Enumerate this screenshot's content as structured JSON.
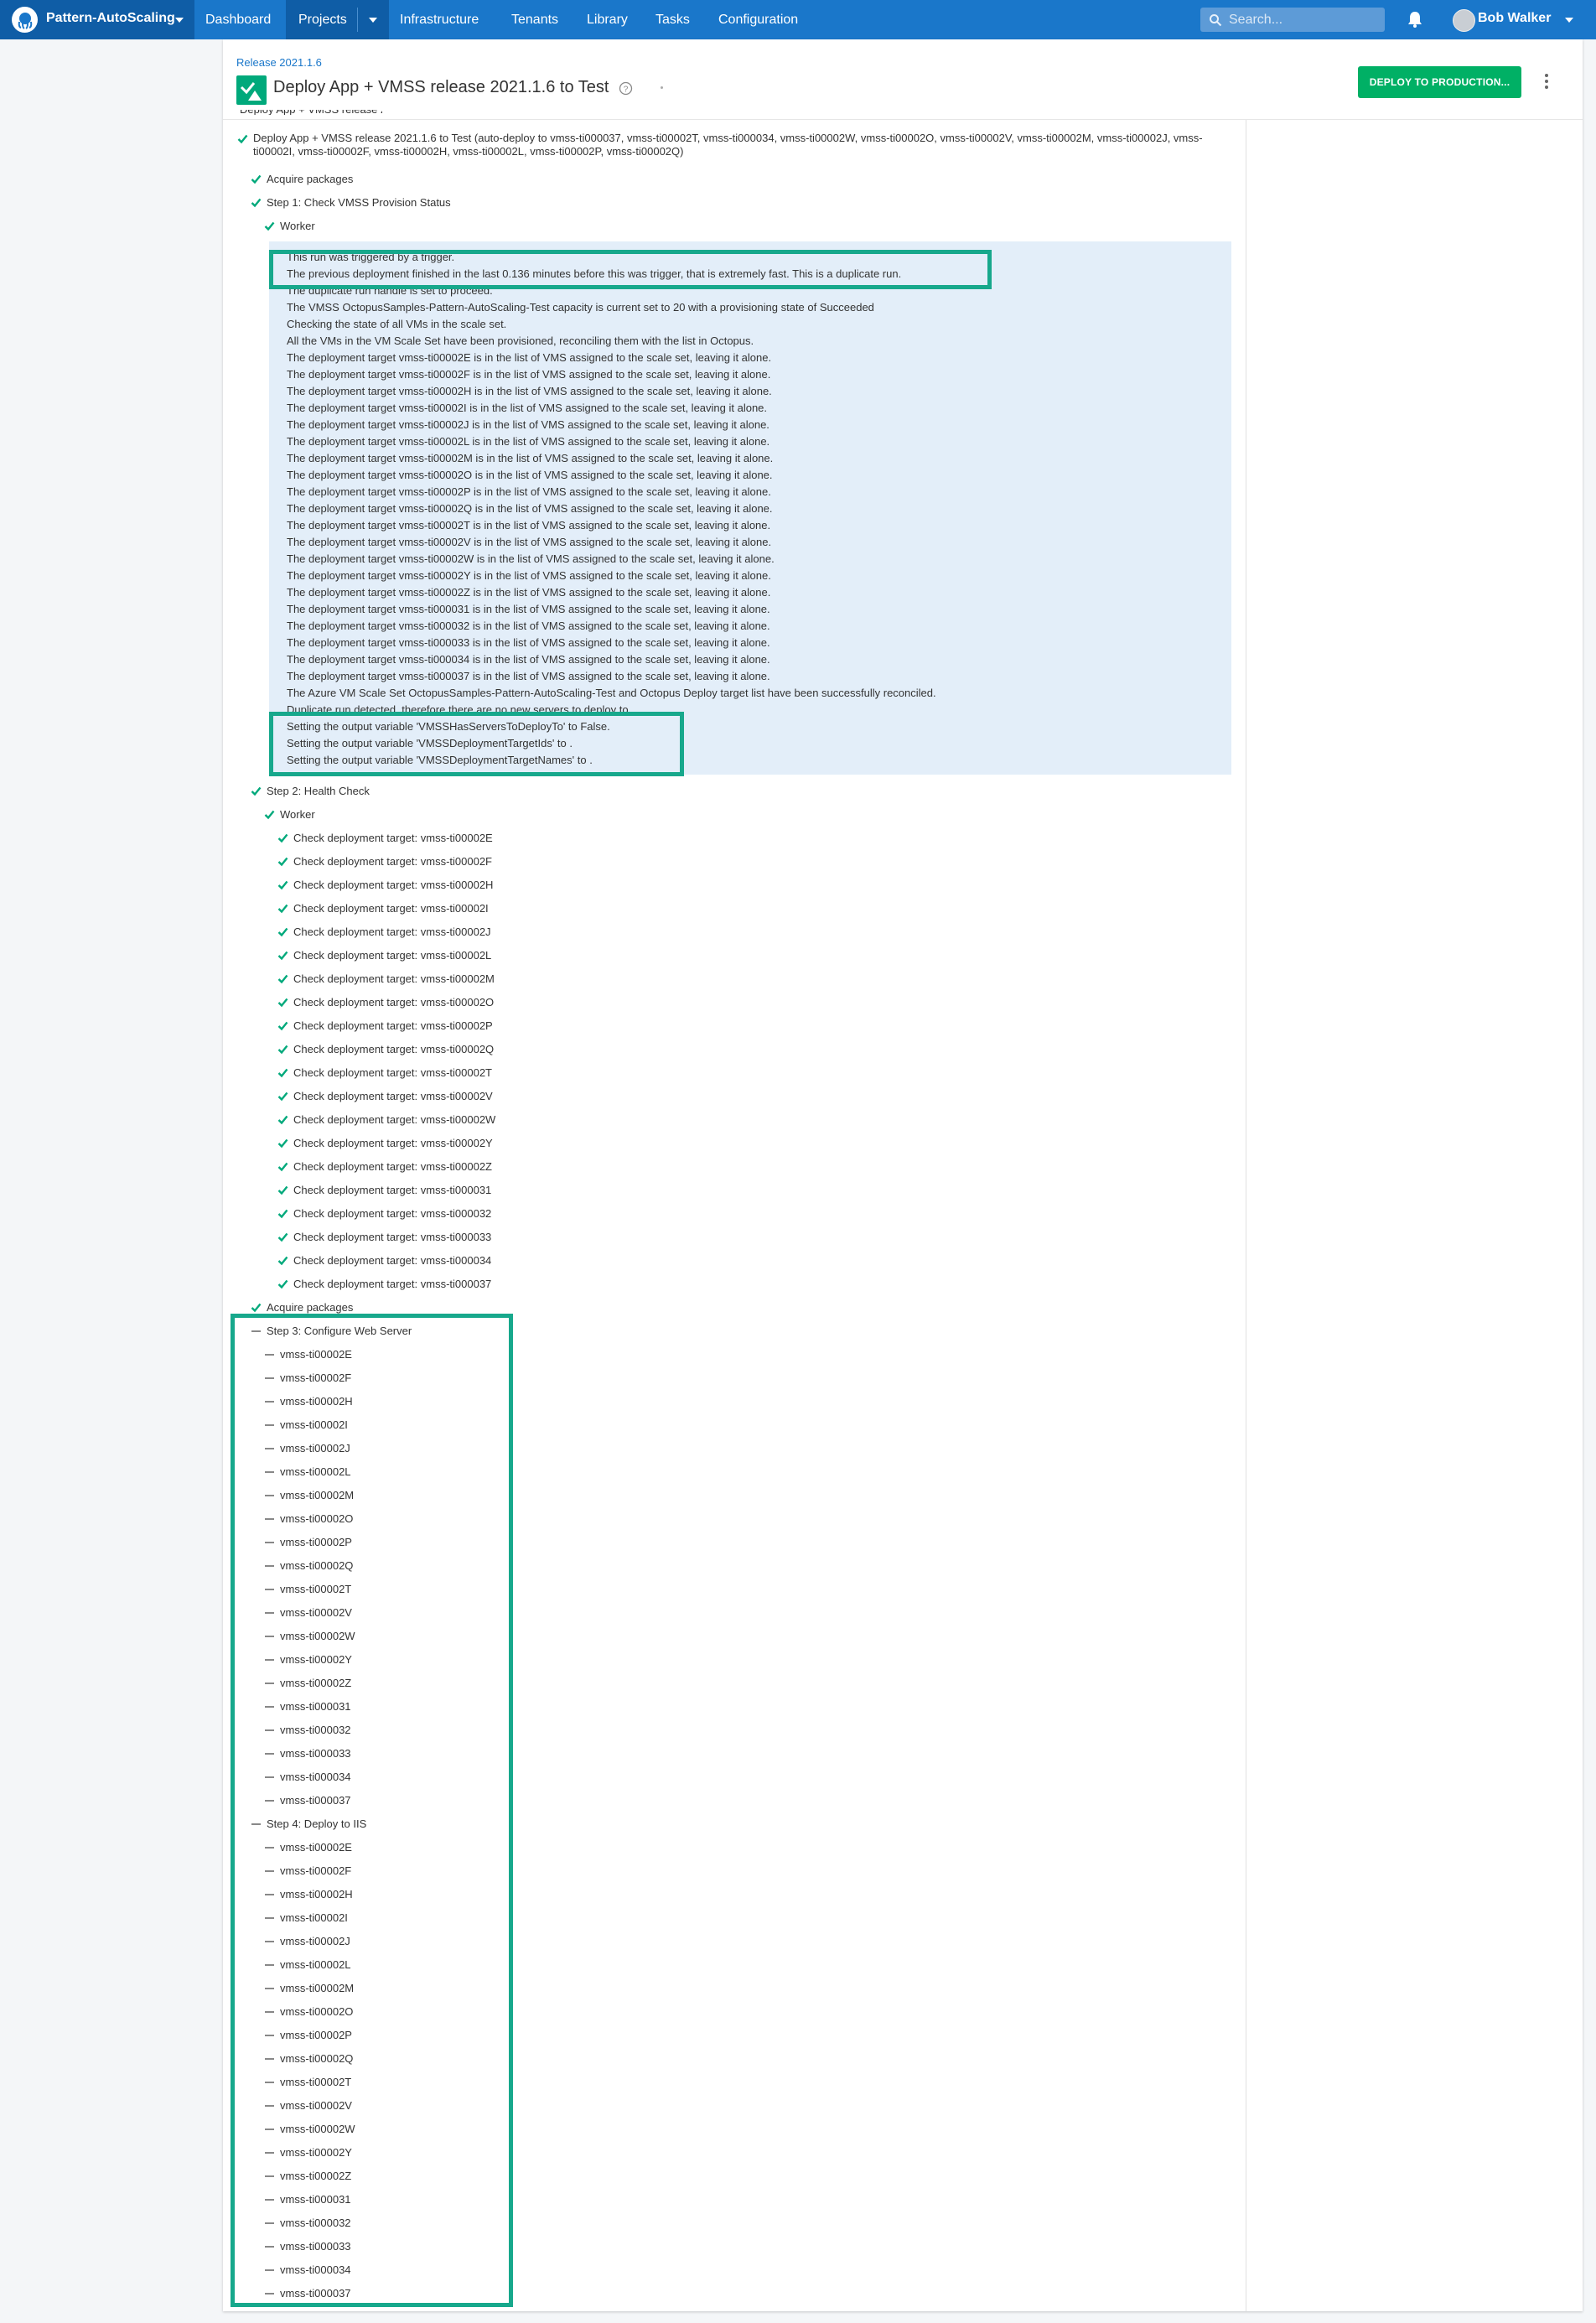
{
  "nav": {
    "project_name": "Pattern-AutoScaling",
    "items": [
      "Dashboard",
      "Projects",
      "Infrastructure",
      "Tenants",
      "Library",
      "Tasks",
      "Configuration"
    ],
    "search_placeholder": "Search...",
    "user_name": "Bob Walker"
  },
  "header": {
    "breadcrumb": "Release 2021.1.6",
    "title": "Deploy App + VMSS release 2021.1.6 to Test",
    "deploy_button": "DEPLOY TO PRODUCTION..."
  },
  "task": {
    "summary": "Deploy App + VMSS release 2021.1.6 to Test (auto-deploy to vmss-ti000037, vmss-ti00002T, vmss-ti000034, vmss-ti00002W, vmss-ti00002O, vmss-ti00002V, vmss-ti00002M, vmss-ti00002J, vmss-ti00002I, vmss-ti00002F, vmss-ti00002H, vmss-ti00002L, vmss-ti00002P, vmss-ti00002Q)",
    "acquire_packages": "Acquire packages",
    "step1": "Step 1: Check VMSS Provision Status",
    "worker": "Worker",
    "step2": "Step 2: Health Check",
    "step3": "Step 3: Configure Web Server",
    "step4": "Step 4: Deploy to IIS"
  },
  "log_lines": [
    "This run was triggered by a trigger.",
    "The previous deployment finished in the last 0.136 minutes before this was trigger, that is extremely fast. This is a duplicate run.",
    "The duplicate run handle is set to proceed.",
    "The VMSS OctopusSamples-Pattern-AutoScaling-Test capacity is current set to 20 with a provisioning state of Succeeded",
    "Checking the state of all VMs in the scale set.",
    "All the VMs in the VM Scale Set have been provisioned, reconciling them with the list in Octopus.",
    "The deployment target vmss-ti00002E is in the list of VMS assigned to the scale set, leaving it alone.",
    "The deployment target vmss-ti00002F is in the list of VMS assigned to the scale set, leaving it alone.",
    "The deployment target vmss-ti00002H is in the list of VMS assigned to the scale set, leaving it alone.",
    "The deployment target vmss-ti00002I is in the list of VMS assigned to the scale set, leaving it alone.",
    "The deployment target vmss-ti00002J is in the list of VMS assigned to the scale set, leaving it alone.",
    "The deployment target vmss-ti00002L is in the list of VMS assigned to the scale set, leaving it alone.",
    "The deployment target vmss-ti00002M is in the list of VMS assigned to the scale set, leaving it alone.",
    "The deployment target vmss-ti00002O is in the list of VMS assigned to the scale set, leaving it alone.",
    "The deployment target vmss-ti00002P is in the list of VMS assigned to the scale set, leaving it alone.",
    "The deployment target vmss-ti00002Q is in the list of VMS assigned to the scale set, leaving it alone.",
    "The deployment target vmss-ti00002T is in the list of VMS assigned to the scale set, leaving it alone.",
    "The deployment target vmss-ti00002V is in the list of VMS assigned to the scale set, leaving it alone.",
    "The deployment target vmss-ti00002W is in the list of VMS assigned to the scale set, leaving it alone.",
    "The deployment target vmss-ti00002Y is in the list of VMS assigned to the scale set, leaving it alone.",
    "The deployment target vmss-ti00002Z is in the list of VMS assigned to the scale set, leaving it alone.",
    "The deployment target vmss-ti000031 is in the list of VMS assigned to the scale set, leaving it alone.",
    "The deployment target vmss-ti000032 is in the list of VMS assigned to the scale set, leaving it alone.",
    "The deployment target vmss-ti000033 is in the list of VMS assigned to the scale set, leaving it alone.",
    "The deployment target vmss-ti000034 is in the list of VMS assigned to the scale set, leaving it alone.",
    "The deployment target vmss-ti000037 is in the list of VMS assigned to the scale set, leaving it alone.",
    "The Azure VM Scale Set OctopusSamples-Pattern-AutoScaling-Test and Octopus Deploy target list have been successfully reconciled.",
    "Duplicate run detected, therefore there are no new servers to deploy to.",
    "Setting the output variable 'VMSSHasServersToDeployTo' to False.",
    "Setting the output variable 'VMSSDeploymentTargetIds' to .",
    "Setting the output variable 'VMSSDeploymentTargetNames' to ."
  ],
  "check_prefix": "Check deployment target: ",
  "targets": [
    "vmss-ti00002E",
    "vmss-ti00002F",
    "vmss-ti00002H",
    "vmss-ti00002I",
    "vmss-ti00002J",
    "vmss-ti00002L",
    "vmss-ti00002M",
    "vmss-ti00002O",
    "vmss-ti00002P",
    "vmss-ti00002Q",
    "vmss-ti00002T",
    "vmss-ti00002V",
    "vmss-ti00002W",
    "vmss-ti00002Y",
    "vmss-ti00002Z",
    "vmss-ti000031",
    "vmss-ti000032",
    "vmss-ti000033",
    "vmss-ti000034",
    "vmss-ti000037"
  ],
  "colors": {
    "nav": "#1a77ca",
    "nav_active": "#0f5da6",
    "success": "#00a97b",
    "highlight": "#17a88c",
    "log_bg": "#e3eef9"
  }
}
